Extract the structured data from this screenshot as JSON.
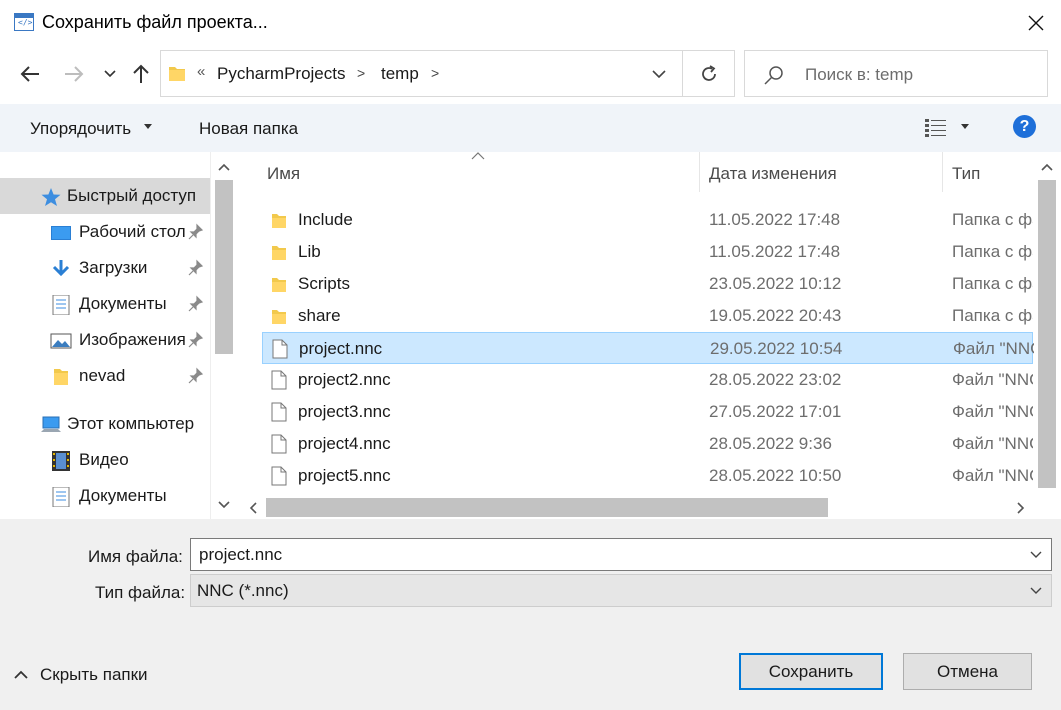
{
  "window": {
    "title": "Сохранить файл проекта...",
    "app_icon_text": "</>",
    "close_icon": "close-icon"
  },
  "nav": {
    "breadcrumb_prefix": "«",
    "breadcrumbs": [
      "PycharmProjects",
      "temp"
    ],
    "separator": ">"
  },
  "search": {
    "placeholder": "Поиск в: temp"
  },
  "toolbar": {
    "organize_label": "Упорядочить",
    "new_folder_label": "Новая папка",
    "help_label": "?"
  },
  "sidebar": {
    "items": [
      {
        "label": "Быстрый доступ",
        "icon": "star-icon"
      },
      {
        "label": "Рабочий стол",
        "icon": "desktop-icon"
      },
      {
        "label": "Загрузки",
        "icon": "download-icon"
      },
      {
        "label": "Документы",
        "icon": "document-icon"
      },
      {
        "label": "Изображения",
        "icon": "pictures-icon"
      },
      {
        "label": "nevad",
        "icon": "folder-icon"
      },
      {
        "label": "Этот компьютер",
        "icon": "computer-icon"
      },
      {
        "label": "Видео",
        "icon": "video-icon"
      },
      {
        "label": "Документы",
        "icon": "document-icon"
      }
    ]
  },
  "files": {
    "columns": [
      "Имя",
      "Дата изменения",
      "Тип"
    ],
    "rows": [
      {
        "name": "Include",
        "date": "11.05.2022 17:48",
        "type": "Папка с файлами",
        "kind": "folder"
      },
      {
        "name": "Lib",
        "date": "11.05.2022 17:48",
        "type": "Папка с файлами",
        "kind": "folder"
      },
      {
        "name": "Scripts",
        "date": "23.05.2022 10:12",
        "type": "Папка с файлами",
        "kind": "folder"
      },
      {
        "name": "share",
        "date": "19.05.2022 20:43",
        "type": "Папка с файлами",
        "kind": "folder"
      },
      {
        "name": "project.nnc",
        "date": "29.05.2022 10:54",
        "type": "Файл \"NNC\"",
        "kind": "file"
      },
      {
        "name": "project2.nnc",
        "date": "28.05.2022 23:02",
        "type": "Файл \"NNC\"",
        "kind": "file"
      },
      {
        "name": "project3.nnc",
        "date": "27.05.2022 17:01",
        "type": "Файл \"NNC\"",
        "kind": "file"
      },
      {
        "name": "project4.nnc",
        "date": "28.05.2022 9:36",
        "type": "Файл \"NNC\"",
        "kind": "file"
      },
      {
        "name": "project5.nnc",
        "date": "28.05.2022 10:50",
        "type": "Файл \"NNC\"",
        "kind": "file"
      }
    ],
    "selected_index": 4
  },
  "form": {
    "filename_label": "Имя файла:",
    "filename_value": "project.nnc",
    "filetype_label": "Тип файла:",
    "filetype_value": "NNC (*.nnc)"
  },
  "footer": {
    "hide_folders_label": "Скрыть папки",
    "save_label": "Сохранить",
    "cancel_label": "Отмена"
  },
  "colors": {
    "accent": "#0078d7",
    "selection": "#cce8ff",
    "toolbar_bg": "#f0f4f9",
    "help": "#1e6fd9"
  }
}
